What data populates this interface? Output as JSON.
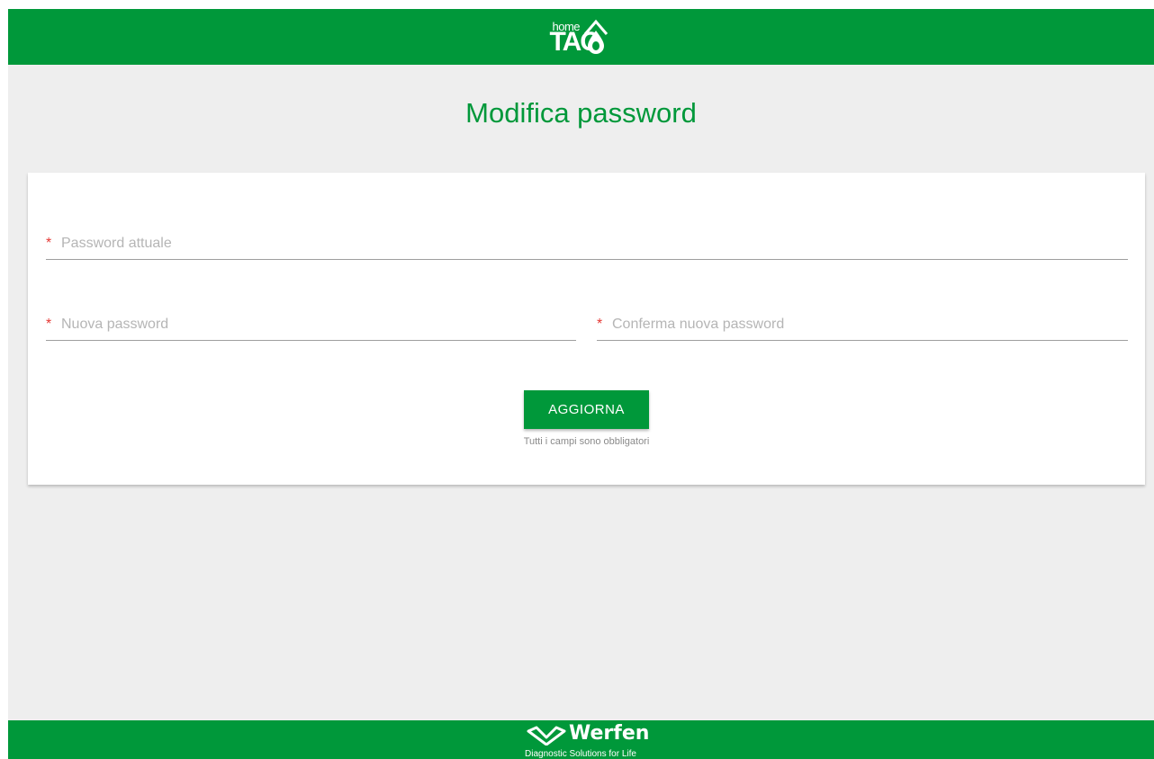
{
  "header": {
    "logo_home": "home",
    "logo_tao": "TAO"
  },
  "page": {
    "title": "Modifica password"
  },
  "form": {
    "required_marker": "*",
    "current_password_placeholder": "Password attuale",
    "new_password_placeholder": "Nuova password",
    "confirm_password_placeholder": "Conferma nuova password",
    "submit_label": "AGGIORNA",
    "required_note": "Tutti i campi sono obbligatori"
  },
  "footer": {
    "brand": "Werfen",
    "tagline": "Diagnostic Solutions for Life"
  },
  "colors": {
    "brand_green": "#00983a",
    "required_red": "#e53935",
    "background": "#eeeeee"
  }
}
